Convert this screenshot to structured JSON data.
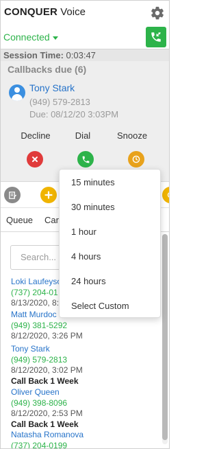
{
  "header": {
    "brand_bold": "CONQUER",
    "brand_light": "Voice",
    "status": "Connected"
  },
  "session": {
    "label": "Session Time:",
    "value": "0:03:47"
  },
  "callbacks": {
    "title": "Callbacks due (6)",
    "contact": {
      "name": "Tony Stark",
      "phone": "(949) 579-2813",
      "due": "Due: 08/12/20 3:03PM"
    },
    "actions": {
      "decline": "Decline",
      "dial": "Dial",
      "snooze": "Snooze"
    }
  },
  "tabs": [
    "Queue",
    "Car"
  ],
  "search": {
    "placeholder": "Search..."
  },
  "snooze_menu": {
    "options": [
      "15 minutes",
      "30 minutes",
      "1 hour",
      "4 hours",
      "24 hours",
      "Select Custom"
    ]
  },
  "list": [
    {
      "name": "Loki Laufeyso",
      "phone": "(737) 204-01",
      "date": "8/13/2020, 8:3"
    },
    {
      "name": "Matt Murdoc",
      "phone": "(949) 381-5292",
      "date": "8/12/2020, 3:26 PM"
    },
    {
      "name": "Tony Stark",
      "phone": "(949) 579-2813",
      "date": "8/12/2020, 3:02 PM",
      "note": "Call Back 1 Week"
    },
    {
      "name": "Oliver Queen",
      "phone": "(949) 398-8096",
      "date": "8/12/2020, 2:53 PM",
      "note": "Call Back 1 Week"
    },
    {
      "name": "Natasha Romanova",
      "phone": "(737) 204-0199"
    }
  ],
  "colors": {
    "green": "#2db34a",
    "blue": "#2673c9",
    "red": "#e03b3b",
    "amber": "#e8a21c"
  }
}
